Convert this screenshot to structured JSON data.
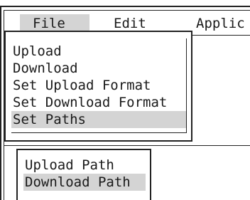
{
  "menubar": {
    "items": [
      {
        "label": "File",
        "selected": true
      },
      {
        "label": "Edit",
        "selected": false
      },
      {
        "label": "Applic",
        "selected": false
      }
    ]
  },
  "file_menu": {
    "items": [
      {
        "label": "Upload"
      },
      {
        "label": "Download"
      },
      {
        "label": "Set Upload Format"
      },
      {
        "label": "Set Download Format"
      },
      {
        "label": "Set Paths",
        "selected": true
      }
    ]
  },
  "paths_submenu": {
    "items": [
      {
        "label": "Upload Path"
      },
      {
        "label": "Download Path",
        "selected": true
      }
    ]
  },
  "colors": {
    "highlight": "#d4d4d4",
    "border": "#222222",
    "background": "#ffffff"
  }
}
